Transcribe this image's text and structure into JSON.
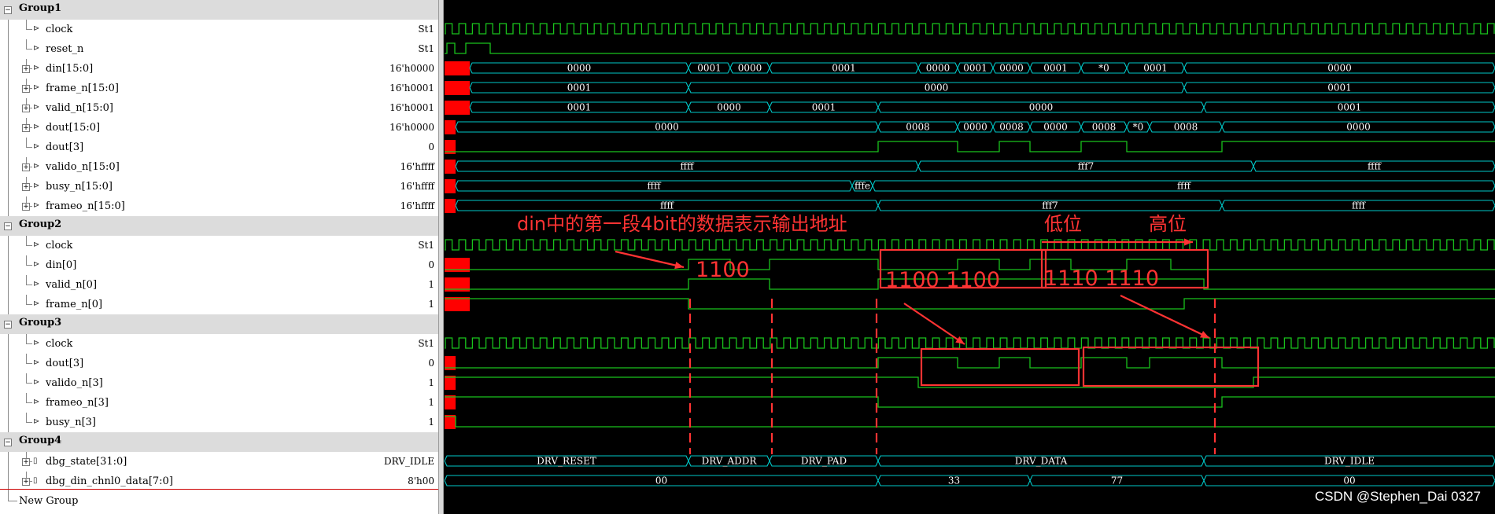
{
  "signal_tree": [
    {
      "kind": "group",
      "label": "Group1"
    },
    {
      "kind": "signal",
      "label": "clock",
      "value": "St1",
      "expandable": false
    },
    {
      "kind": "signal",
      "label": "reset_n",
      "value": "St1",
      "expandable": false
    },
    {
      "kind": "signal",
      "label": "din[15:0]",
      "value": "16'h0000",
      "expandable": true
    },
    {
      "kind": "signal",
      "label": "frame_n[15:0]",
      "value": "16'h0001",
      "expandable": true
    },
    {
      "kind": "signal",
      "label": "valid_n[15:0]",
      "value": "16'h0001",
      "expandable": true
    },
    {
      "kind": "signal",
      "label": "dout[15:0]",
      "value": "16'h0000",
      "expandable": true
    },
    {
      "kind": "signal",
      "label": "dout[3]",
      "value": "0",
      "expandable": false
    },
    {
      "kind": "signal",
      "label": "valido_n[15:0]",
      "value": "16'hffff",
      "expandable": true
    },
    {
      "kind": "signal",
      "label": "busy_n[15:0]",
      "value": "16'hffff",
      "expandable": true
    },
    {
      "kind": "signal",
      "label": "frameo_n[15:0]",
      "value": "16'hffff",
      "expandable": true
    },
    {
      "kind": "group",
      "label": "Group2"
    },
    {
      "kind": "signal",
      "label": "clock",
      "value": "St1",
      "expandable": false
    },
    {
      "kind": "signal",
      "label": "din[0]",
      "value": "0",
      "expandable": false
    },
    {
      "kind": "signal",
      "label": "valid_n[0]",
      "value": "1",
      "expandable": false
    },
    {
      "kind": "signal",
      "label": "frame_n[0]",
      "value": "1",
      "expandable": false
    },
    {
      "kind": "group",
      "label": "Group3"
    },
    {
      "kind": "signal",
      "label": "clock",
      "value": "St1",
      "expandable": false
    },
    {
      "kind": "signal",
      "label": "dout[3]",
      "value": "0",
      "expandable": false
    },
    {
      "kind": "signal",
      "label": "valido_n[3]",
      "value": "1",
      "expandable": false
    },
    {
      "kind": "signal",
      "label": "frameo_n[3]",
      "value": "1",
      "expandable": false
    },
    {
      "kind": "signal",
      "label": "busy_n[3]",
      "value": "1",
      "expandable": false
    },
    {
      "kind": "group",
      "label": "Group4"
    },
    {
      "kind": "signal",
      "label": "dbg_state[31:0]",
      "value": "DRV_IDLE",
      "expandable": true
    },
    {
      "kind": "signal",
      "label": "dbg_din_chnl0_data[7:0]",
      "value": "8'h00",
      "expandable": true
    },
    {
      "kind": "newgroup",
      "label": "New Group"
    }
  ],
  "bus_values": {
    "din": [
      "0000",
      "0001",
      "0000",
      "0001",
      "0000",
      "0001",
      "0000",
      "0001",
      "*0",
      "0001",
      "0000"
    ],
    "frame_n": [
      "0001",
      "0000",
      "0001"
    ],
    "valid_n": [
      "0001",
      "0000",
      "0001",
      "0000",
      "0001"
    ],
    "dout": [
      "0000",
      "0008",
      "0000",
      "0008",
      "0000",
      "0008",
      "*0",
      "0008",
      "0000"
    ],
    "valido_n": [
      "ffff",
      "fff7",
      "ffff"
    ],
    "busy_n": [
      "ffff",
      "fffe",
      "ffff"
    ],
    "frameo_n": [
      "ffff",
      "fff7",
      "ffff"
    ],
    "dbg_state": [
      "DRV_RESET",
      "DRV_ADDR",
      "DRV_PAD",
      "DRV_DATA",
      "DRV_IDLE"
    ],
    "dbg_din_chnl0_data": [
      "00",
      "33",
      "77",
      "00"
    ]
  },
  "annotations": {
    "title": "din中的第一段4bit的数据表示输出地址",
    "addr_bits": "1100",
    "data_bits_1": "1100 1100",
    "data_bits_2": "1110 1110",
    "low_label": "低位",
    "high_label": "高位"
  },
  "watermark": "CSDN @Stephen_Dai 0327",
  "colors": {
    "wave": "#19c21c",
    "bus": "#00c8c8",
    "marker": "#ff0000",
    "annotation": "#ff3333"
  }
}
